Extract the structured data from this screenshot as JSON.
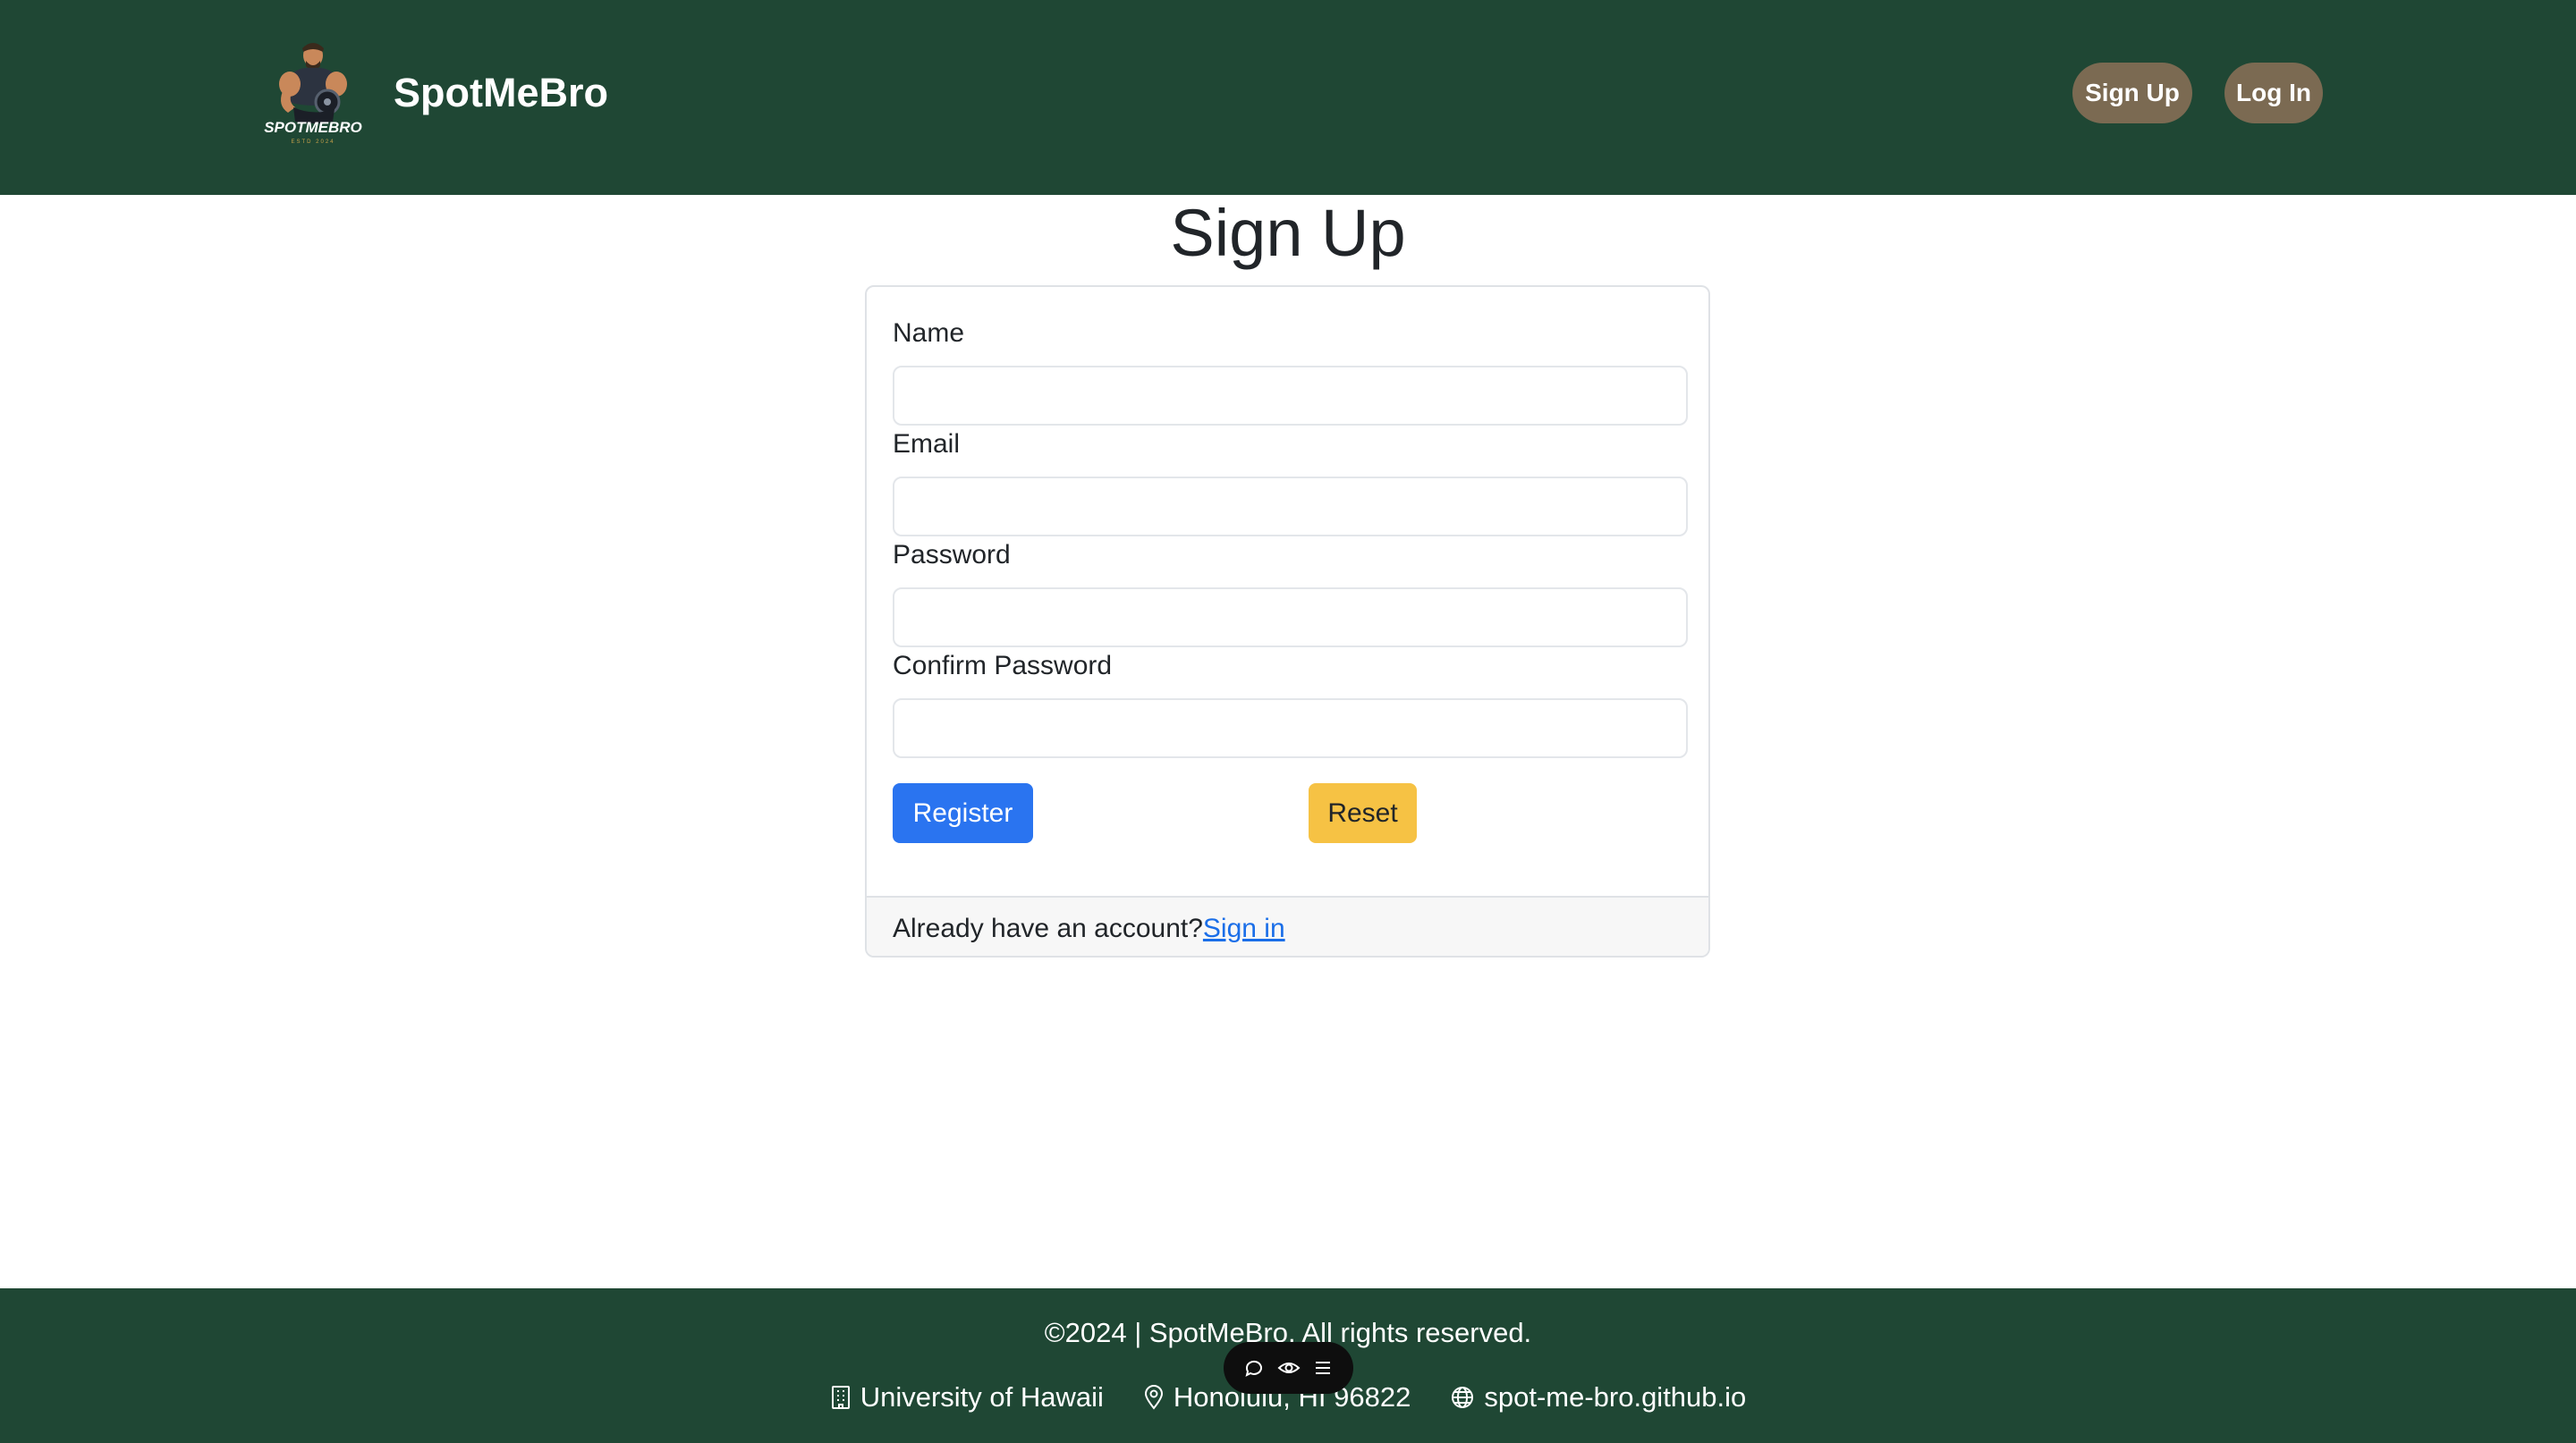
{
  "header": {
    "brand_title": "SpotMeBro",
    "logo_text": "SPOTMEBRO",
    "logo_subtext": "ESTD 2024",
    "signup_label": "Sign Up",
    "login_label": "Log In"
  },
  "page": {
    "title": "Sign Up"
  },
  "form": {
    "name_label": "Name",
    "name_value": "",
    "email_label": "Email",
    "email_value": "",
    "password_label": "Password",
    "password_value": "",
    "confirm_label": "Confirm Password",
    "confirm_value": "",
    "register_label": "Register",
    "reset_label": "Reset",
    "account_prompt": "Already have an account?",
    "signin_link": "Sign in"
  },
  "footer": {
    "copyright": "©2024 | SpotMeBro. All rights reserved.",
    "university": "University of Hawaii",
    "location": "Honolulu, HI 96822",
    "website": "spot-me-bro.github.io"
  },
  "colors": {
    "header_bg": "#1f4734",
    "nav_button_bg": "#7b6a52",
    "register_bg": "#2a74f0",
    "reset_bg": "#f6c244",
    "link": "#1a6ee8"
  },
  "icons": {
    "university": "building-icon",
    "location": "map-pin-icon",
    "website": "globe-icon",
    "toolbar": [
      "chat-bubble-icon",
      "eye-icon",
      "menu-icon"
    ]
  }
}
